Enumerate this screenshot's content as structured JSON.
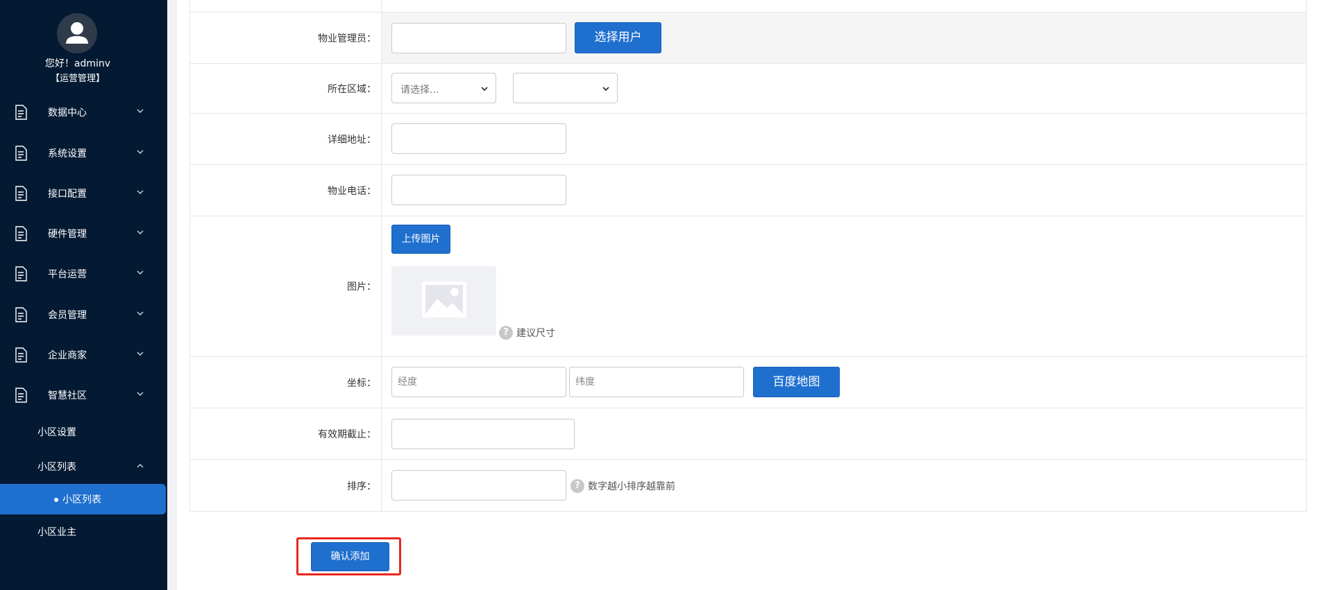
{
  "user": {
    "greeting": "您好！adminv",
    "role": "【运营管理】"
  },
  "sidebar": {
    "menus": [
      {
        "label": "数据中心"
      },
      {
        "label": "系统设置"
      },
      {
        "label": "接口配置"
      },
      {
        "label": "硬件管理"
      },
      {
        "label": "平台运营"
      },
      {
        "label": "会员管理"
      },
      {
        "label": "企业商家"
      },
      {
        "label": "智慧社区"
      }
    ],
    "sub": [
      {
        "label": "小区设置"
      },
      {
        "label": "小区列表"
      },
      {
        "label": "小区业主"
      }
    ],
    "active_leaf": "小区列表"
  },
  "form": {
    "manager": {
      "label": "物业管理员：",
      "value": "",
      "button": "选择用户"
    },
    "region": {
      "label": "所在区域：",
      "province_placeholder": "请选择...",
      "city_value": ""
    },
    "address": {
      "label": "详细地址：",
      "value": ""
    },
    "phone": {
      "label": "物业电话：",
      "value": ""
    },
    "image": {
      "label": "图片：",
      "upload_button": "上传图片",
      "size_hint": "建议尺寸"
    },
    "coords": {
      "label": "坐标：",
      "lng_placeholder": "经度",
      "lat_placeholder": "纬度",
      "map_button": "百度地图"
    },
    "expiry": {
      "label": "有效期截止：",
      "value": ""
    },
    "sort": {
      "label": "排序：",
      "value": "",
      "hint": "数字越小排序越靠前"
    },
    "submit_label": "确认添加"
  },
  "colors": {
    "sidebar_bg": "#041a33",
    "accent": "#1f6fcf",
    "highlight": "#e8261c"
  }
}
